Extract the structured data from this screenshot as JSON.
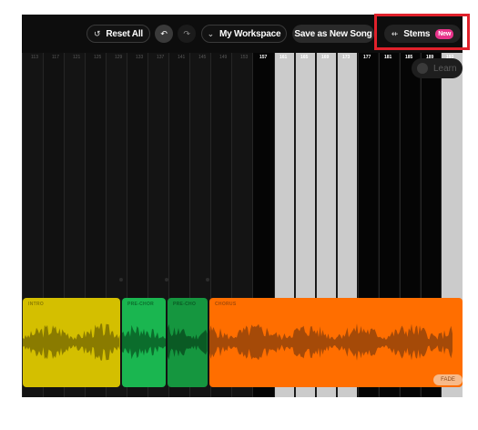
{
  "toolbar": {
    "reset_label": "Reset All",
    "workspace_label": "My Workspace",
    "save_as_label": "Save as New Song",
    "stems_label": "Stems",
    "stems_badge": "New"
  },
  "learn": {
    "label": "Learn"
  },
  "timeline": {
    "bars": [
      "113",
      "117",
      "121",
      "125",
      "129",
      "133",
      "137",
      "141",
      "145",
      "149",
      "153",
      "157",
      "161",
      "165",
      "169",
      "173",
      "177",
      "181",
      "185",
      "189",
      "193"
    ]
  },
  "clips": [
    {
      "label": "INTRO",
      "color": "#d4bf00",
      "wave": "#8a7b00"
    },
    {
      "label": "PRE-CHOR",
      "color": "#1ab650",
      "wave": "#0b6d2c"
    },
    {
      "label": "PRE-CHO",
      "color": "#15963f",
      "wave": "#0a5a24"
    },
    {
      "label": "CHORUS",
      "color": "#ff6e00",
      "wave": "#a54a08"
    }
  ],
  "fade": {
    "label": "FADE"
  }
}
